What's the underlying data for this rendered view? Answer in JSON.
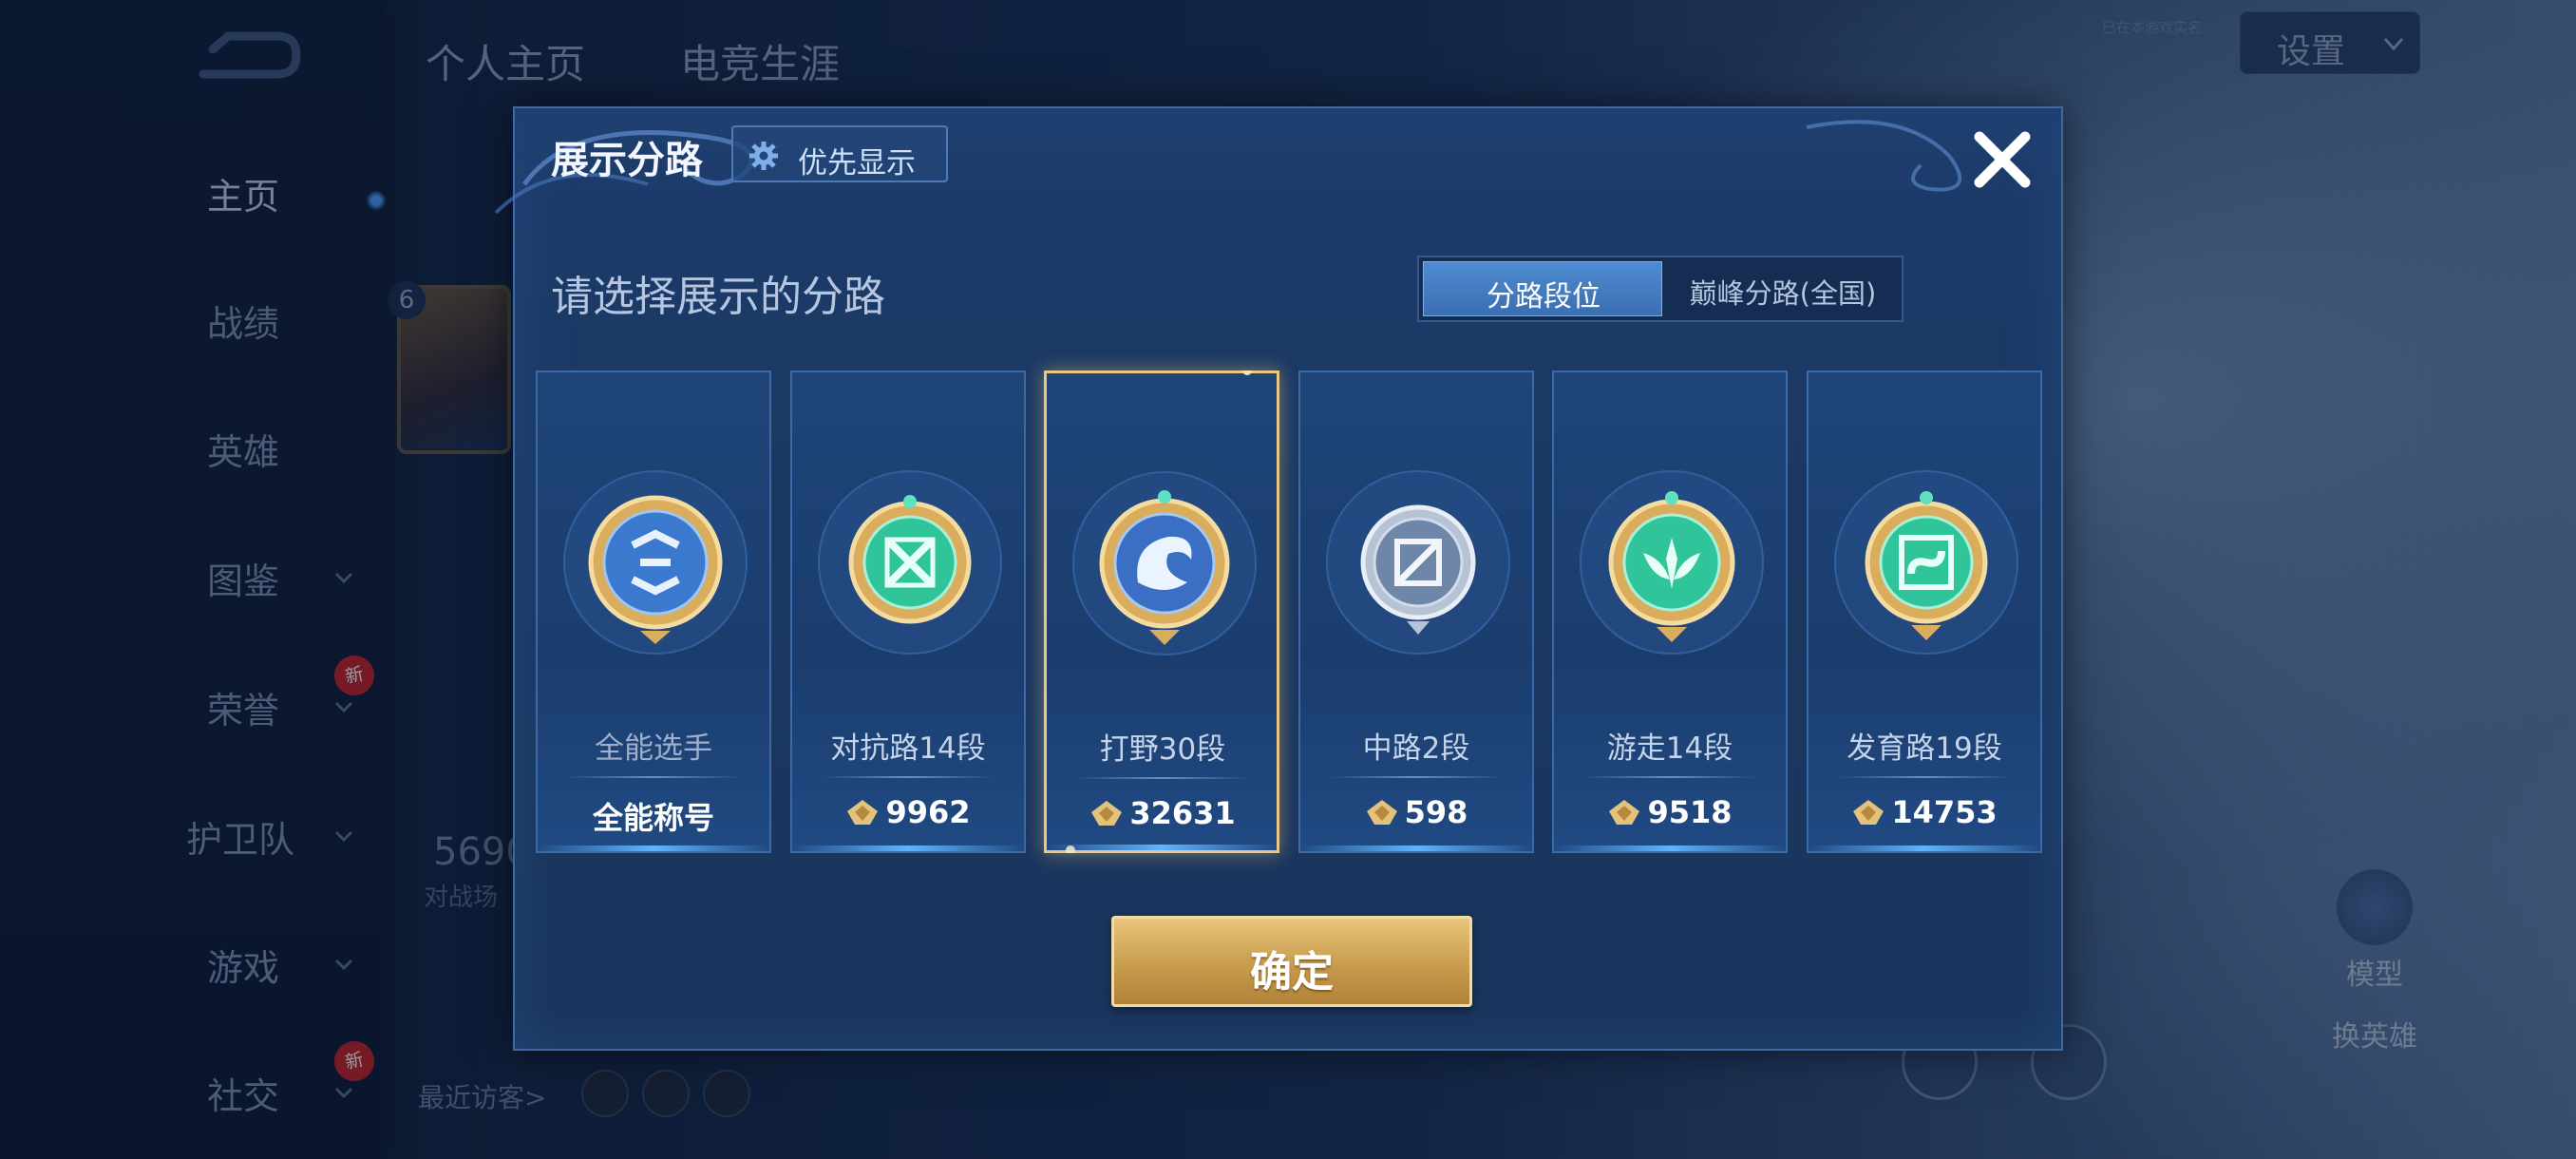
{
  "sidebar": {
    "items": [
      {
        "label": "主页",
        "active": true
      },
      {
        "label": "战绩"
      },
      {
        "label": "英雄"
      },
      {
        "label": "图鉴",
        "expand": true
      },
      {
        "label": "荣誉",
        "expand": true,
        "badge": "新"
      },
      {
        "label": "护卫队",
        "expand": true
      },
      {
        "label": "游戏",
        "expand": true
      },
      {
        "label": "社交",
        "expand": true,
        "badge": "新"
      }
    ]
  },
  "background": {
    "tabs": [
      "个人主页",
      "电竞生涯"
    ],
    "settings_label": "设置",
    "hint_text": "已在本游戏实名",
    "portrait_level": "6",
    "stat_value": "5690",
    "stat_label": "对战场",
    "recent_visitors": "最近访客>",
    "actions": {
      "model": "模型",
      "change_hero": "换英雄"
    },
    "new_badge": "新"
  },
  "dialog": {
    "title": "展示分路",
    "priority_button": "优先显示",
    "subtitle": "请选择展示的分路",
    "segment": {
      "options": [
        "分路段位",
        "巅峰分路(全国)"
      ],
      "selected": 0
    },
    "cards": [
      {
        "name": "全能选手",
        "score": "全能称号",
        "emblem": "all-round-emblem",
        "color": "#4a86d8",
        "has_icon": false
      },
      {
        "name": "对抗路14段",
        "score": "9962",
        "emblem": "clash-lane-emblem",
        "color": "#2fc49a",
        "has_icon": true
      },
      {
        "name": "打野30段",
        "score": "32631",
        "emblem": "jungle-emblem",
        "color": "#4a86d8",
        "has_icon": true,
        "selected": true
      },
      {
        "name": "中路2段",
        "score": "598",
        "emblem": "mid-lane-emblem",
        "color": "#8fa6c4",
        "has_icon": true
      },
      {
        "name": "游走14段",
        "score": "9518",
        "emblem": "roam-emblem",
        "color": "#2fc49a",
        "has_icon": true
      },
      {
        "name": "发育路19段",
        "score": "14753",
        "emblem": "farm-lane-emblem",
        "color": "#2fc49a",
        "has_icon": true
      }
    ],
    "confirm_button": "确定",
    "colors": {
      "accent_gold": "#e8c67c",
      "selected_border": "#e9c783",
      "segment_active": "#4f8ad0"
    }
  }
}
